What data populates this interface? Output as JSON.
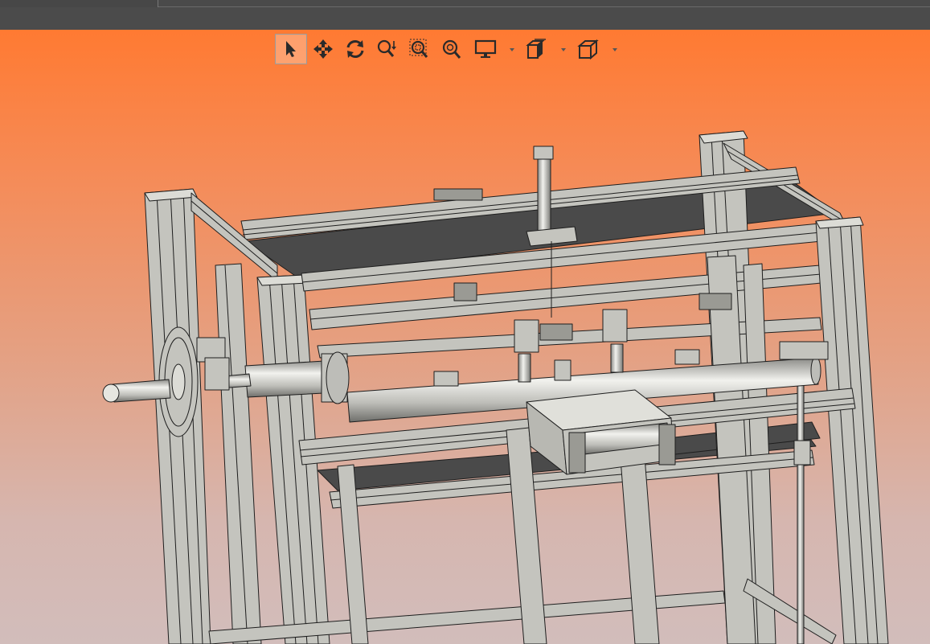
{
  "window": {
    "tab_strip": "",
    "title": ""
  },
  "toolbar": {
    "buttons": [
      {
        "id": "select",
        "icon": "pointer-arrow-icon",
        "active": true
      },
      {
        "id": "pan",
        "icon": "move-arrows-icon"
      },
      {
        "id": "rotate",
        "icon": "rotate-icon"
      },
      {
        "id": "zoom",
        "icon": "zoom-dynamic-icon"
      },
      {
        "id": "zoom-window",
        "icon": "zoom-window-icon"
      },
      {
        "id": "zoom-all",
        "icon": "zoom-fit-icon"
      },
      {
        "id": "display-mode",
        "icon": "monitor-icon",
        "dropdown": true
      },
      {
        "id": "section",
        "icon": "clip-plane-icon",
        "dropdown": true
      },
      {
        "id": "view-orientation",
        "icon": "cube-view-icon",
        "dropdown": true
      }
    ]
  },
  "viewport": {
    "background_top": "#ff7a32",
    "background_bottom": "#d2bdbb",
    "model_color": "#c4c4be",
    "edge_color": "#1e1e1e",
    "plate_color": "#4a4a4a"
  }
}
